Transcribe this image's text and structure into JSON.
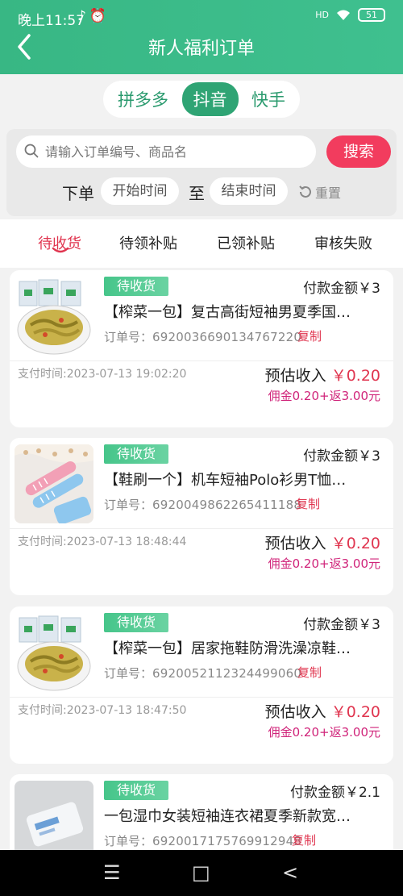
{
  "status": {
    "time": "晚上11:57",
    "icons": "♪⏰",
    "signal": "HD",
    "battery": "51"
  },
  "header": {
    "title": "新人福利订单"
  },
  "platforms": [
    {
      "label": "拼多多",
      "active": false
    },
    {
      "label": "抖音",
      "active": true
    },
    {
      "label": "快手",
      "active": false
    }
  ],
  "search": {
    "placeholder": "请输入订单编号、商品名",
    "button": "搜索"
  },
  "date_filter": {
    "label": "下单",
    "start": "开始时间",
    "sep": "至",
    "end": "结束时间",
    "reset": "重置"
  },
  "tabs": [
    "待收货",
    "待领补贴",
    "已领补贴",
    "审核失败"
  ],
  "orders": [
    {
      "status": "待收货",
      "pay_amount": "付款金额￥3",
      "title": "【榨菜一包】复古高街短袖男夏季国…",
      "order_label": "订单号：",
      "order_no": "6920036690134767220",
      "copy": "复制",
      "pay_time": "支付时间:2023-07-13 19:02:20",
      "income_label": "预估收入",
      "income": "￥0.20",
      "commission": "佣金0.20+返3.00元"
    },
    {
      "status": "待收货",
      "pay_amount": "付款金额￥3",
      "title": "【鞋刷一个】机车短袖Polo衫男T恤…",
      "order_label": "订单号：",
      "order_no": "6920049862265411188",
      "copy": "复制",
      "pay_time": "支付时间:2023-07-13 18:48:44",
      "income_label": "预估收入",
      "income": "￥0.20",
      "commission": "佣金0.20+返3.00元"
    },
    {
      "status": "待收货",
      "pay_amount": "付款金额￥3",
      "title": "【榨菜一包】居家拖鞋防滑洗澡凉鞋…",
      "order_label": "订单号：",
      "order_no": "6920052112324499060",
      "copy": "复制",
      "pay_time": "支付时间:2023-07-13 18:47:50",
      "income_label": "预估收入",
      "income": "￥0.20",
      "commission": "佣金0.20+返3.00元"
    },
    {
      "status": "待收货",
      "pay_amount": "付款金额￥2.1",
      "title": "一包湿巾女装短袖连衣裙夏季新款宽…",
      "order_label": "订单号：",
      "order_no": "6920017175769912948",
      "copy": "复制"
    }
  ],
  "system_nav": {
    "menu": "☰",
    "home": "□",
    "back": "<"
  },
  "colors": {
    "primary": "#38b784",
    "accent": "#f23c5e",
    "price": "#e0354f",
    "commission": "#d0247a"
  }
}
